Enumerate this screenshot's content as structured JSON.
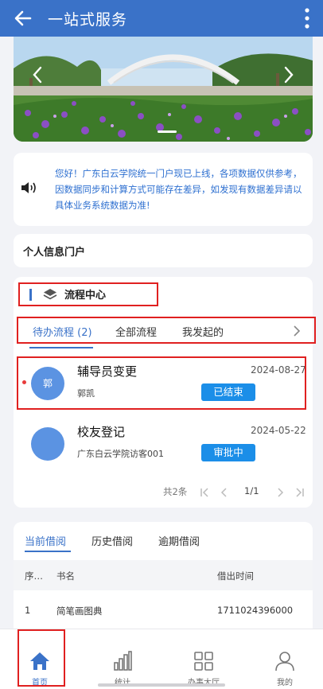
{
  "header": {
    "title": "一站式服务",
    "back_icon": "arrow-left-icon",
    "more_icon": "more-vertical-icon"
  },
  "banner": {
    "image": "campus-gate-flowers-photo",
    "prev_icon": "chevron-left-icon",
    "next_icon": "chevron-right-icon"
  },
  "notice": {
    "icon": "speaker-icon",
    "text": "您好！广东白云学院统一门户现已上线，各项数据仅供参考，因数据同步和计算方式可能存在差异，如发现有数据差异请以具体业务系统数据为准!"
  },
  "portal": {
    "label": "个人信息门户"
  },
  "flow": {
    "title": "流程中心",
    "icon": "layers-icon",
    "tabs": [
      "待办流程 (2)",
      "全部流程",
      "我发起的"
    ],
    "tabs_more_icon": "chevron-right-icon",
    "items": [
      {
        "avatar_text": "郭",
        "name": "辅导员变更",
        "date": "2024-08-27",
        "sub": "郭凯",
        "status": "已结束",
        "unread": true
      },
      {
        "avatar_text": "",
        "name": "校友登记",
        "date": "2024-05-22",
        "sub": "广东白云学院访客001",
        "status": "审批中",
        "unread": false
      }
    ],
    "pager": {
      "total": "共2条",
      "page": "1/1"
    }
  },
  "borrow": {
    "tabs": [
      "当前借阅",
      "历史借阅",
      "逾期借阅"
    ],
    "columns": [
      "序…",
      "书名",
      "借出时间"
    ],
    "rows": [
      {
        "index": "1",
        "title": "简笔画图典",
        "time": "1711024396000"
      }
    ]
  },
  "nav": [
    {
      "label": "首页",
      "icon": "home-icon"
    },
    {
      "label": "统计",
      "icon": "bar-chart-icon"
    },
    {
      "label": "办事大厅",
      "icon": "grid-icon"
    },
    {
      "label": "我的",
      "icon": "user-icon"
    }
  ],
  "colors": {
    "primary": "#3a72c8",
    "status": "#1b8ee8",
    "highlight": "#e02020"
  }
}
